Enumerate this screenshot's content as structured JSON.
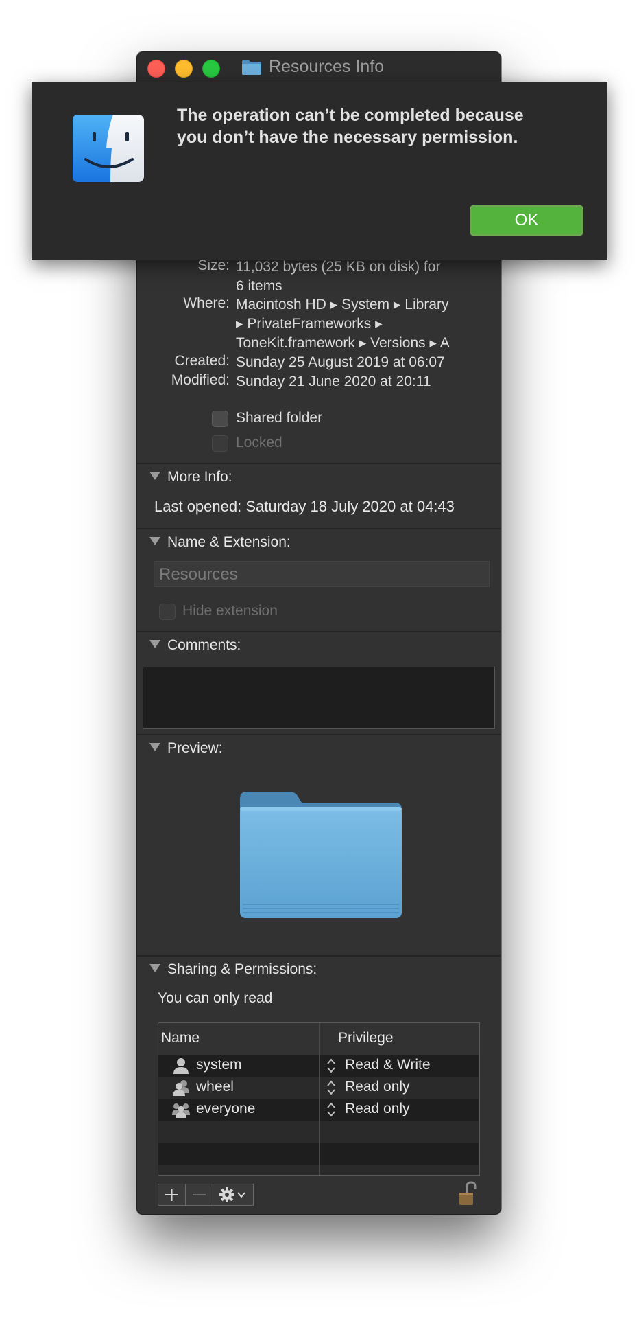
{
  "window": {
    "title": "Resources Info"
  },
  "general": {
    "size_label": "Size:",
    "size_value_lines": [
      "11,032 bytes (25 KB on disk) for",
      "6 items"
    ],
    "where_label": "Where:",
    "where_value_lines": [
      "Macintosh HD ▸ System ▸ Library",
      "▸ PrivateFrameworks ▸",
      "ToneKit.framework ▸ Versions ▸ A"
    ],
    "created_label": "Created:",
    "created_value": "Sunday 25 August 2019 at 06:07",
    "modified_label": "Modified:",
    "modified_value": "Sunday 21 June 2020 at 20:11",
    "shared_folder_label": "Shared folder",
    "shared_folder_checked": false,
    "locked_label": "Locked",
    "locked_checked": false
  },
  "more_info": {
    "header": "More Info:",
    "last_opened": "Last opened: Saturday 18 July 2020 at 04:43"
  },
  "name_extension": {
    "header": "Name & Extension:",
    "name_value": "Resources",
    "hide_extension_label": "Hide extension",
    "hide_extension_checked": false
  },
  "comments": {
    "header": "Comments:",
    "value": ""
  },
  "preview": {
    "header": "Preview:",
    "icon": "folder-icon"
  },
  "sharing": {
    "header": "Sharing & Permissions:",
    "status": "You can only read",
    "columns": [
      "Name",
      "Privilege"
    ],
    "rows": [
      {
        "name": "system",
        "privilege": "Read & Write",
        "icon": "user-icon"
      },
      {
        "name": "wheel",
        "privilege": "Read only",
        "icon": "group-icon"
      },
      {
        "name": "everyone",
        "privilege": "Read only",
        "icon": "everyone-icon"
      }
    ],
    "buttons": {
      "add": "+",
      "remove": "—",
      "action": "gear-icon"
    },
    "lock_state": "unlocked"
  },
  "alert": {
    "message_lines": [
      "The operation can’t be completed because",
      "you don’t have the necessary permission."
    ],
    "ok_label": "OK",
    "icon": "finder-icon"
  },
  "colors": {
    "window_bg": "#323232",
    "ok_button": "#53b33c",
    "close": "#fe5f57",
    "minimize": "#febc2e",
    "maximize": "#28c840",
    "folder": "#6cb0dc"
  }
}
